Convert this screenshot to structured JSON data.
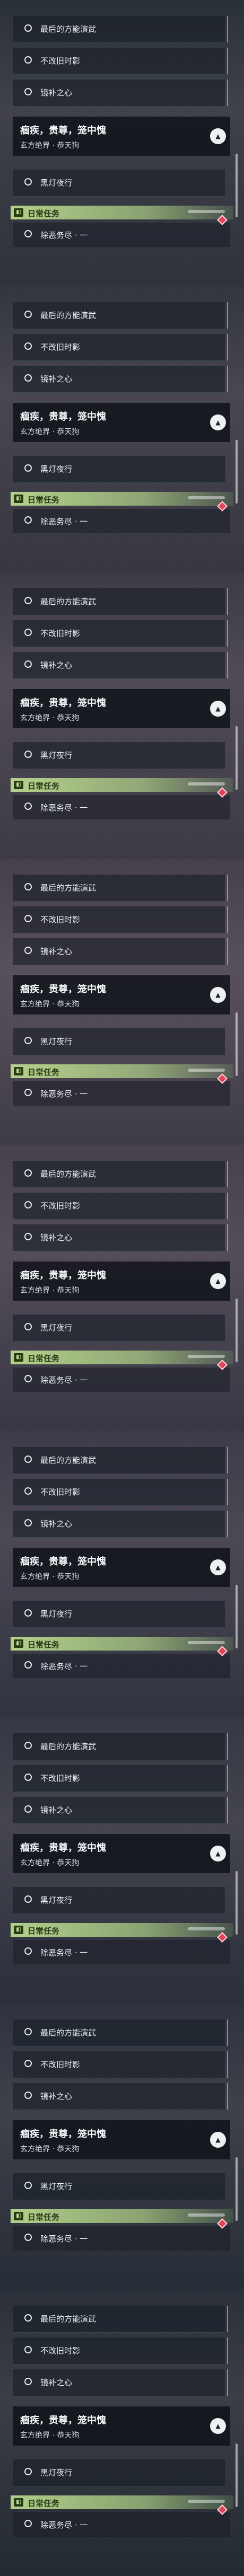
{
  "quest_group": {
    "title": "痼疾，贵尊，笼中愧",
    "subtitle": "玄方绝界 · 恭天狗",
    "items": [
      {
        "label": "最后的方能演武"
      },
      {
        "label": "不改旧时影"
      },
      {
        "label": "镜补之心"
      }
    ],
    "after_item": {
      "label": "黑灯夜行"
    },
    "collapse_icon": "chevron-up-icon"
  },
  "daily": {
    "label": "日常任务",
    "badge_icon": "daily-quest-icon",
    "task": {
      "label": "除恶务尽 · 一"
    },
    "marker_icon": "diamond-marker-icon",
    "marker_color": "#e0455a"
  },
  "repeats": 9
}
